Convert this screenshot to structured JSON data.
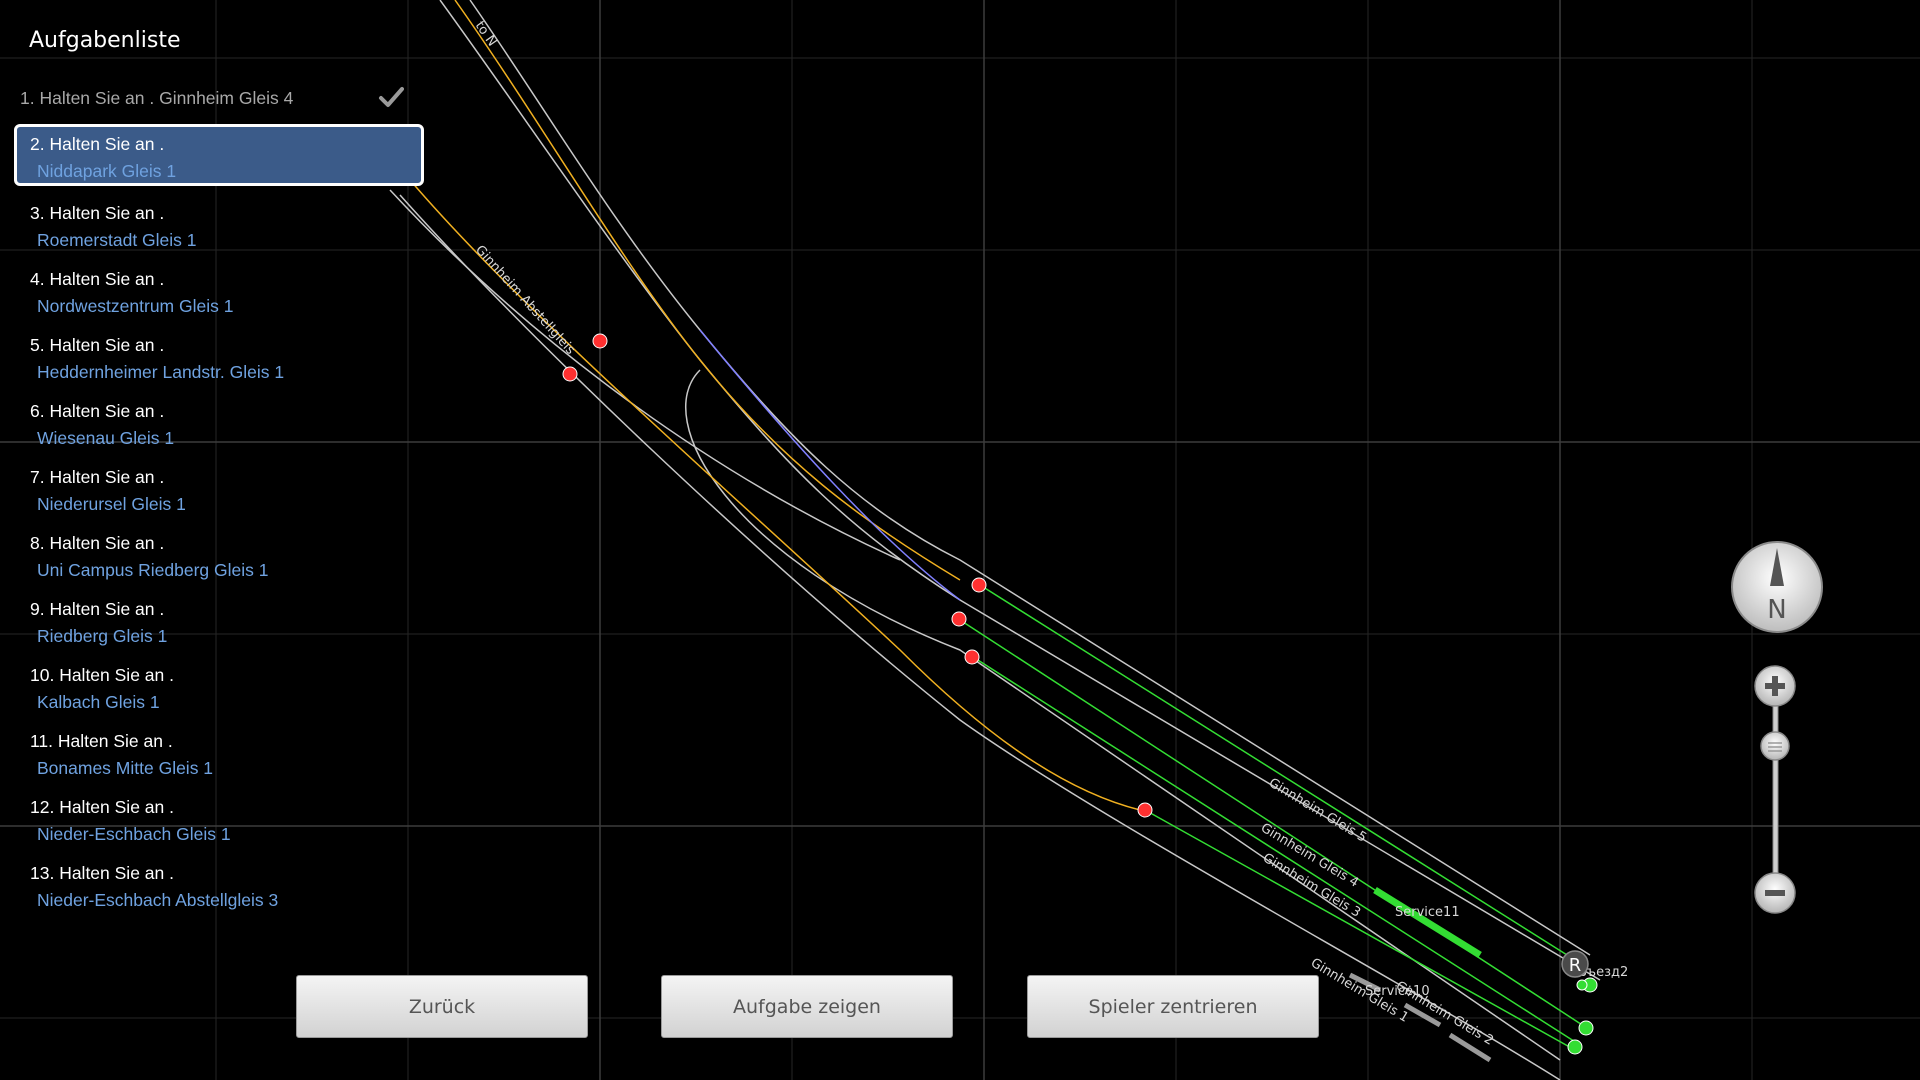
{
  "task_list": {
    "title": "Aufgabenliste",
    "completed": [
      {
        "label": "1. Halten Sie an  . Ginnheim Gleis 4"
      }
    ],
    "tasks": [
      {
        "line1": "2. Halten Sie an  .",
        "line2": "Niddapark Gleis 1",
        "selected": true
      },
      {
        "line1": "3. Halten Sie an  .",
        "line2": "Roemerstadt Gleis 1"
      },
      {
        "line1": "4. Halten Sie an  .",
        "line2": "Nordwestzentrum Gleis 1"
      },
      {
        "line1": "5. Halten Sie an  .",
        "line2": "Heddernheimer Landstr. Gleis 1"
      },
      {
        "line1": "6. Halten Sie an  .",
        "line2": "Wiesenau Gleis 1"
      },
      {
        "line1": "7. Halten Sie an  .",
        "line2": "Niederursel Gleis 1"
      },
      {
        "line1": "8. Halten Sie an  .",
        "line2": "Uni Campus Riedberg Gleis 1"
      },
      {
        "line1": "9. Halten Sie an  .",
        "line2": "Riedberg Gleis 1"
      },
      {
        "line1": "10. Halten Sie an  .",
        "line2": "Kalbach Gleis 1"
      },
      {
        "line1": "11. Halten Sie an  .",
        "line2": "Bonames Mitte Gleis 1"
      },
      {
        "line1": "12. Halten Sie an  .",
        "line2": "Nieder-Eschbach Gleis 1"
      },
      {
        "line1": "13. Halten Sie an  .",
        "line2": "Nieder-Eschbach Abstellgleis 3"
      }
    ]
  },
  "buttons": {
    "back": "Zurück",
    "show_task": "Aufgabe zeigen",
    "center_player": "Spieler zentrieren"
  },
  "map": {
    "track_labels": {
      "to_n": "to N",
      "abstellgleis": "Ginnheim Abstellgleis",
      "gleis5": "Ginnheim Gleis 5",
      "gleis4": "Ginnheim Gleis 4",
      "gleis3": "Ginnheim Gleis 3",
      "gleis2": "Ginnheim Gleis 2",
      "gleis1": "Ginnheim Gleis 1"
    },
    "trains": {
      "service11": "Service11",
      "service10": "Service10"
    },
    "entry_label": "Въезд2",
    "entry_marker": "R",
    "compass_label": "N"
  },
  "colors": {
    "background": "#000000",
    "grid": "#2a2a2a",
    "track": "#c8c8c8",
    "route_yellow": "#f0b020",
    "route_blue": "#8080ff",
    "signal_red": "#ff3030",
    "signal_green": "#33dd33",
    "selected_task_bg": "#3b5b89",
    "station_text": "#6fa2e0"
  },
  "icons": [
    "check-icon",
    "compass-icon",
    "zoom-in-icon",
    "zoom-out-icon"
  ]
}
